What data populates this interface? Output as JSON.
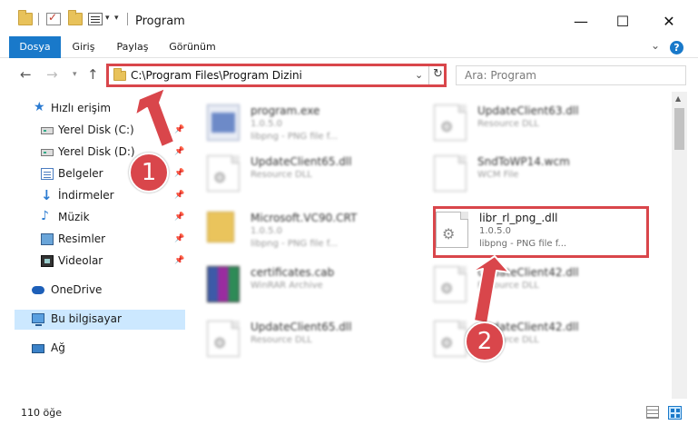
{
  "window": {
    "title": "Program"
  },
  "window_controls": {
    "minimize": "—",
    "maximize": "☐",
    "close": "✕"
  },
  "ribbon": {
    "tabs": [
      {
        "label": "Dosya"
      },
      {
        "label": "Giriş"
      },
      {
        "label": "Paylaş"
      },
      {
        "label": "Görünüm"
      }
    ],
    "help": "?"
  },
  "nav": {
    "address": "C:\\Program Files\\Program Dizini",
    "search_placeholder": "Ara: Program"
  },
  "sidebar": {
    "items": [
      {
        "label": "Hızlı erişim",
        "icon": "star-icon"
      },
      {
        "label": "Yerel Disk (C:)",
        "icon": "drive-icon",
        "pinned": true
      },
      {
        "label": "Yerel Disk (D:)",
        "icon": "drive-icon",
        "pinned": true
      },
      {
        "label": "Belgeler",
        "icon": "documents-icon",
        "pinned": true
      },
      {
        "label": "İndirmeler",
        "icon": "downloads-icon",
        "pinned": true
      },
      {
        "label": "Müzik",
        "icon": "music-icon",
        "pinned": true
      },
      {
        "label": "Resimler",
        "icon": "pictures-icon",
        "pinned": true
      },
      {
        "label": "Videolar",
        "icon": "videos-icon",
        "pinned": true
      },
      {
        "label": "OneDrive",
        "icon": "cloud-icon"
      },
      {
        "label": "Bu bilgisayar",
        "icon": "computer-icon",
        "selected": true
      },
      {
        "label": "Ağ",
        "icon": "network-icon"
      }
    ]
  },
  "files": [
    {
      "name": "program.exe",
      "line1": "1.0.5.0",
      "line2": "libpng - PNG file f...",
      "icon": "exe-icon"
    },
    {
      "name": "UpdateClient63.dll",
      "line1": "Resource DLL",
      "line2": "",
      "icon": "dll-icon"
    },
    {
      "name": "UpdateClient65.dll",
      "line1": "Resource DLL",
      "line2": "",
      "icon": "dll-icon"
    },
    {
      "name": "SndToWP14.wcm",
      "line1": "WCM File",
      "line2": "",
      "icon": "file-icon"
    },
    {
      "name": "Microsoft.VC90.CRT",
      "line1": "1.0.5.0",
      "line2": "libpng - PNG file f...",
      "icon": "folder-icon"
    },
    {
      "name": "libr_rl_png_.dll",
      "line1": "1.0.5.0",
      "line2": "libpng - PNG file f...",
      "icon": "dll-icon",
      "highlighted": true
    },
    {
      "name": "certificates.cab",
      "line1": "WinRAR Archive",
      "line2": "",
      "icon": "rar-icon"
    },
    {
      "name": "UpdateClient42.dll",
      "line1": "Resource DLL",
      "line2": "",
      "icon": "dll-icon"
    },
    {
      "name": "UpdateClient65.dll",
      "line1": "Resource DLL",
      "line2": "",
      "icon": "dll-icon"
    },
    {
      "name": "UpdateClient42.dll",
      "line1": "Resource DLL",
      "line2": "",
      "icon": "dll-icon"
    }
  ],
  "status": {
    "count": "110 öğe"
  },
  "annotations": {
    "step1": "1",
    "step2": "2",
    "accent": "#d9464b"
  },
  "colors": {
    "ribbon_active": "#1979ca",
    "selected_bg": "#cce8ff",
    "highlight": "#d9464b"
  }
}
